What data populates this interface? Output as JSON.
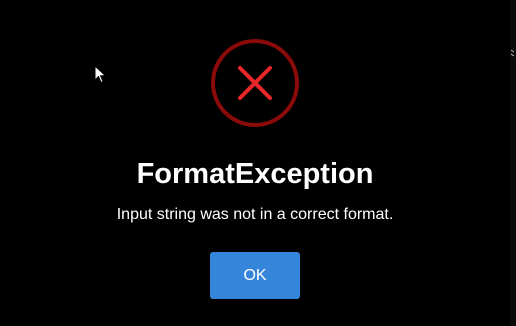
{
  "dialog": {
    "icon": "error-x-circle-icon",
    "title": "FormatException",
    "message": "Input string was not in a correct format.",
    "ok_label": "OK"
  },
  "colors": {
    "background": "#000000",
    "icon_ring": "#8b0a0a",
    "icon_x": "#e8262a",
    "button": "#3585da",
    "text": "#ffffff"
  },
  "cursor": {
    "icon": "mouse-pointer-icon"
  }
}
